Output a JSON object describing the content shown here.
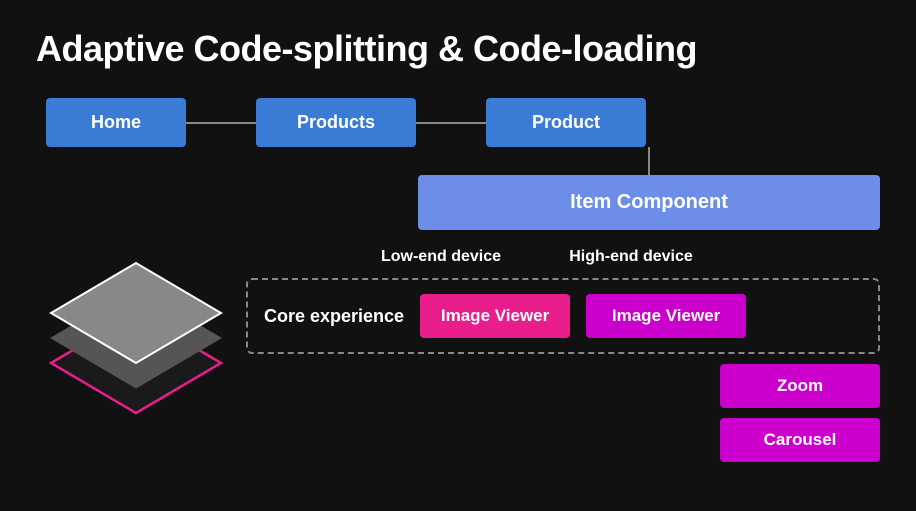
{
  "title": "Adaptive Code-splitting & Code-loading",
  "routes": {
    "home": "Home",
    "products": "Products",
    "product": "Product"
  },
  "item_component": "Item Component",
  "device_labels": {
    "low_end": "Low-end device",
    "high_end": "High-end device"
  },
  "core_experience": "Core experience",
  "components": {
    "image_viewer_pink": "Image Viewer",
    "image_viewer_magenta": "Image Viewer",
    "zoom": "Zoom",
    "carousel": "Carousel"
  }
}
